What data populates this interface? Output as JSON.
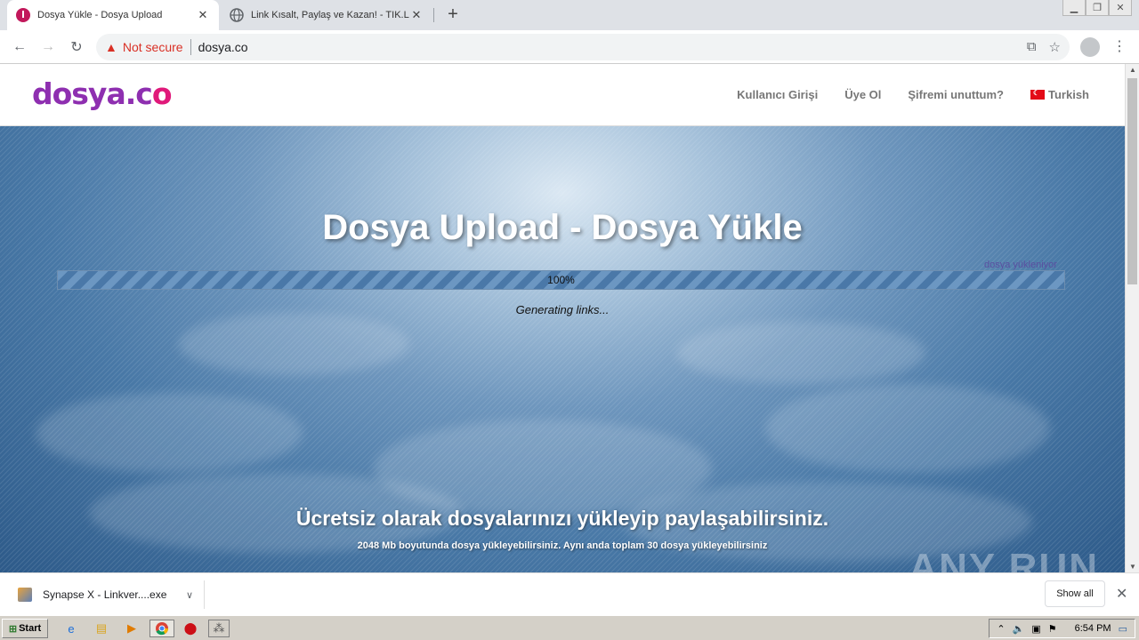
{
  "browser": {
    "tabs": [
      {
        "title": "Dosya Yükle - Dosya Upload",
        "favicon": "dosya-favicon",
        "active": true
      },
      {
        "title": "Link Kısalt, Paylaş ve Kazan! - TIK.LA",
        "favicon": "globe-icon",
        "active": false
      }
    ],
    "new_tab_symbol": "+",
    "security_label": "Not secure",
    "url": "dosya.co",
    "window_controls": [
      "minimize-icon",
      "restore-icon",
      "close-icon"
    ]
  },
  "site": {
    "logo_main": "dosya.c",
    "logo_accent": "o",
    "nav": {
      "login": "Kullanıcı Girişi",
      "register": "Üye Ol",
      "forgot_password": "Şifremi unuttum?",
      "language": "Turkish"
    },
    "hero": {
      "title": "Dosya Upload - Dosya Yükle",
      "upload_status": "dosya yükleniyor",
      "progress_text": "100%",
      "progress_value": 1.0,
      "generating": "Generating links...",
      "subtitle": "Ücretsiz olarak dosyalarınızı yükleyip paylaşabilirsiniz.",
      "note": "2048 Mb boyutunda dosya yükleyebilirsiniz. Aynı anda toplam 30 dosya yükleyebilirsiniz"
    }
  },
  "watermark": "ANY RUN",
  "download_shelf": {
    "file_name": "Synapse X - Linkver....exe",
    "show_all": "Show all"
  },
  "taskbar": {
    "start_label": "Start",
    "clock": "6:54 PM"
  },
  "colors": {
    "brand_purple": "#8e2fb0",
    "brand_pink": "#e0197a",
    "warning_red": "#d93025"
  }
}
